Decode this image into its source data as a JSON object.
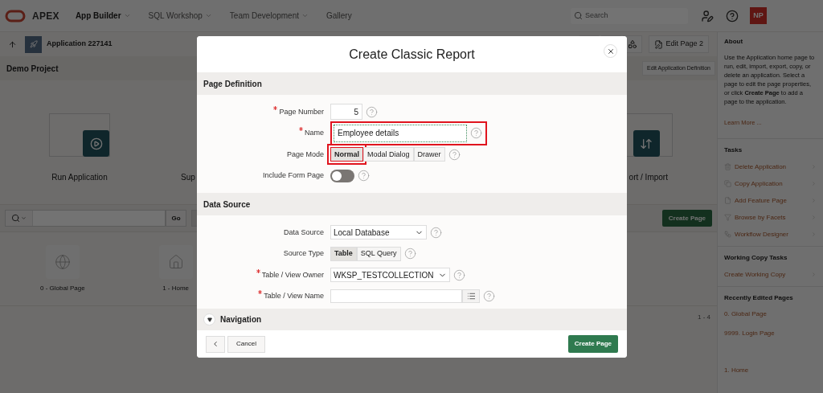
{
  "top_nav": {
    "logo": "APEX",
    "menus": [
      {
        "label": "App Builder",
        "selected": true,
        "dropdown": true
      },
      {
        "label": "SQL Workshop",
        "selected": false,
        "dropdown": true
      },
      {
        "label": "Team Development",
        "selected": false,
        "dropdown": true
      },
      {
        "label": "Gallery",
        "selected": false,
        "dropdown": false
      }
    ],
    "search": {
      "placeholder": "Search"
    },
    "avatar": "NP"
  },
  "app_bar": {
    "title": "Application 227141",
    "edit_button": "Edit Page 2"
  },
  "workspace": {
    "title": "Demo Project",
    "edit_button": "Edit Application Definition",
    "cards": [
      {
        "label": "Run Application",
        "kind": "play"
      },
      {
        "label": "Sup",
        "kind": "plain"
      },
      {
        "label": "ort / Import",
        "kind": "arrows"
      }
    ],
    "search_button": "Go",
    "create_button": "Create Page",
    "pages": [
      {
        "label": "0 - Global Page",
        "kind": "globe"
      },
      {
        "label": "1 - Home",
        "kind": "home"
      }
    ],
    "count": "1 - 4"
  },
  "sidebar": {
    "about_title": "About",
    "about_text": "Use the Application home page to run, edit, import, export, copy, or delete an application. Select a page to edit the page properties, or click **Create Page** to add a page to the application.",
    "learn_more": "Learn More ...",
    "tasks_title": "Tasks",
    "tasks": [
      {
        "label": "Delete Application",
        "kind": "trash"
      },
      {
        "label": "Copy Application",
        "kind": "copy"
      },
      {
        "label": "Add Feature Page",
        "kind": "file"
      },
      {
        "label": "Browse by Facets",
        "kind": "filter"
      },
      {
        "label": "Workflow Designer",
        "kind": "flow"
      }
    ],
    "working_title": "Working Copy Tasks",
    "working_tasks": [
      "Create Working Copy"
    ],
    "recent_title": "Recently Edited Pages",
    "recent": [
      "0. Global Page",
      "9999. Login Page",
      "1. Home"
    ]
  },
  "dialog": {
    "title": "Create Classic Report",
    "sections": [
      {
        "title": "Page Definition",
        "fields": [
          {
            "label": "Page Number",
            "kind": "number",
            "required": true,
            "highlighted": false,
            "value": "5"
          },
          {
            "label": "Name",
            "kind": "text",
            "required": true,
            "highlighted": true,
            "value": "Employee details"
          },
          {
            "label": "Page Mode",
            "kind": "segmented",
            "required": false,
            "highlighted": false,
            "options": [
              {
                "label": "Normal",
                "selected": true,
                "highlighted": true
              },
              {
                "label": "Modal Dialog",
                "selected": false,
                "highlighted": false
              },
              {
                "label": "Drawer",
                "selected": false,
                "highlighted": false
              }
            ]
          },
          {
            "label": "Include Form Page",
            "kind": "switch",
            "required": false,
            "highlighted": false,
            "on": false
          }
        ]
      },
      {
        "title": "Data Source",
        "fields": [
          {
            "label": "Data Source",
            "kind": "select",
            "required": false,
            "highlighted": false,
            "value": "Local Database"
          },
          {
            "label": "Source Type",
            "kind": "segmented",
            "required": false,
            "highlighted": false,
            "options": [
              {
                "label": "Table",
                "selected": true,
                "highlighted": false
              },
              {
                "label": "SQL Query",
                "selected": false,
                "highlighted": false
              }
            ]
          },
          {
            "label": "Table / View Owner",
            "kind": "select",
            "required": true,
            "highlighted": false,
            "value": "WKSP_TESTCOLLECTION"
          },
          {
            "label": "Table / View Name",
            "kind": "picker",
            "required": true,
            "highlighted": false
          }
        ]
      }
    ],
    "collapsed_section": {
      "title": "Navigation",
      "expanded": false
    },
    "cancel_button": "Cancel",
    "create_button": "Create Page"
  }
}
